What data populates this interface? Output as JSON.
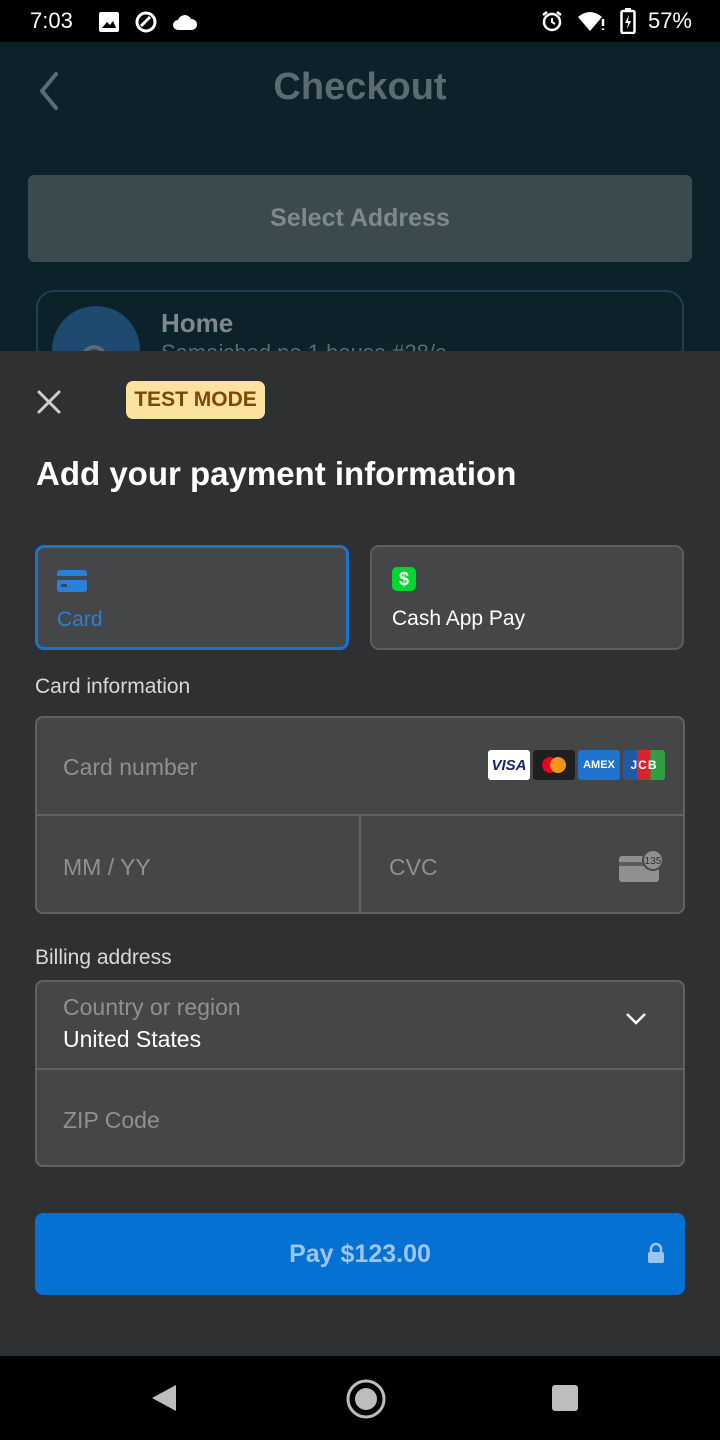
{
  "status_bar": {
    "time": "7:03",
    "battery": "57%"
  },
  "background": {
    "title": "Checkout",
    "select_address_label": "Select Address",
    "address": {
      "name": "Home",
      "line": "Samaishad no 1 house #28/a"
    }
  },
  "sheet": {
    "badge": "TEST MODE",
    "title": "Add your payment information",
    "methods": [
      {
        "label": "Card",
        "selected": true
      },
      {
        "label": "Cash App Pay",
        "selected": false
      }
    ],
    "card_section_label": "Card information",
    "card_number_placeholder": "Card number",
    "expiry_placeholder": "MM / YY",
    "cvc_placeholder": "CVC",
    "cvc_icon_text": "135",
    "brands": [
      "VISA",
      "mastercard",
      "AMEX",
      "JCB"
    ],
    "billing_label": "Billing address",
    "country_label": "Country or region",
    "country_value": "United States",
    "zip_placeholder": "ZIP Code",
    "pay_button": "Pay $123.00"
  },
  "colors": {
    "accent": "#0571d3",
    "sheet_bg": "#2f3031",
    "field_bg": "#454648",
    "badge_bg": "#fde1a1",
    "cash_app_green": "#00d632"
  }
}
